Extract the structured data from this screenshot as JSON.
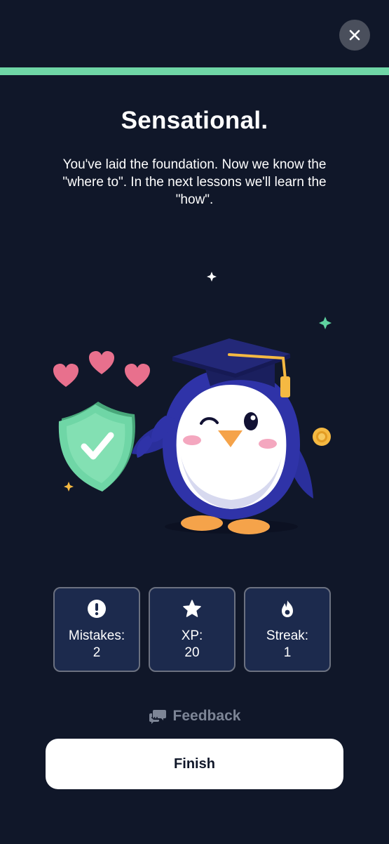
{
  "header": {
    "close_icon": "close-icon",
    "progress_percent": 100
  },
  "main": {
    "headline": "Sensational.",
    "message": "You've laid the foundation. Now we know the \"where to\". In the next lessons we'll learn the \"how\"."
  },
  "stats": [
    {
      "icon": "exclamation-icon",
      "label": "Mistakes:",
      "value": "2"
    },
    {
      "icon": "star-icon",
      "label": "XP:",
      "value": "20"
    },
    {
      "icon": "flame-icon",
      "label": "Streak:",
      "value": "1"
    }
  ],
  "feedback": {
    "icon": "chat-bubbles-icon",
    "label": "Feedback"
  },
  "finish_button": {
    "label": "Finish"
  },
  "colors": {
    "background": "#101729",
    "accent": "#6fd6a6",
    "card": "#1c2a4d",
    "muted": "#7d8596"
  }
}
